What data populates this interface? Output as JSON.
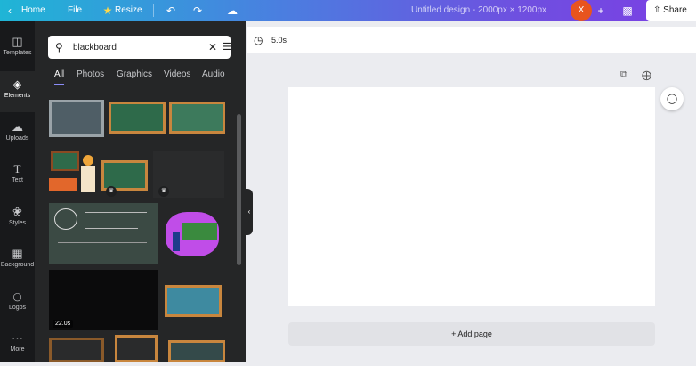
{
  "topbar": {
    "home_label": "Home",
    "file_label": "File",
    "resize_label": "Resize",
    "title": "Untitled design - 2000px × 1200px",
    "avatar_initial": "X",
    "share_label": "Share"
  },
  "rail": {
    "items": [
      {
        "label": "Templates",
        "icon": "templates-icon"
      },
      {
        "label": "Elements",
        "icon": "elements-icon"
      },
      {
        "label": "Uploads",
        "icon": "uploads-icon"
      },
      {
        "label": "Text",
        "icon": "text-icon"
      },
      {
        "label": "Styles",
        "icon": "styles-icon"
      },
      {
        "label": "Background",
        "icon": "background-icon"
      },
      {
        "label": "Logos",
        "icon": "logos-icon"
      },
      {
        "label": "More",
        "icon": "more-icon"
      }
    ]
  },
  "panel": {
    "search_value": "blackboard",
    "tabs": [
      "All",
      "Photos",
      "Graphics",
      "Videos",
      "Audio"
    ],
    "video_duration": "22.0s"
  },
  "canvas": {
    "duration": "5.0s",
    "add_page_label": "+ Add page"
  },
  "colors": {
    "accent": "#8b8cf7",
    "board_green": "#2e6a4a",
    "board_frame": "#c8863e"
  }
}
